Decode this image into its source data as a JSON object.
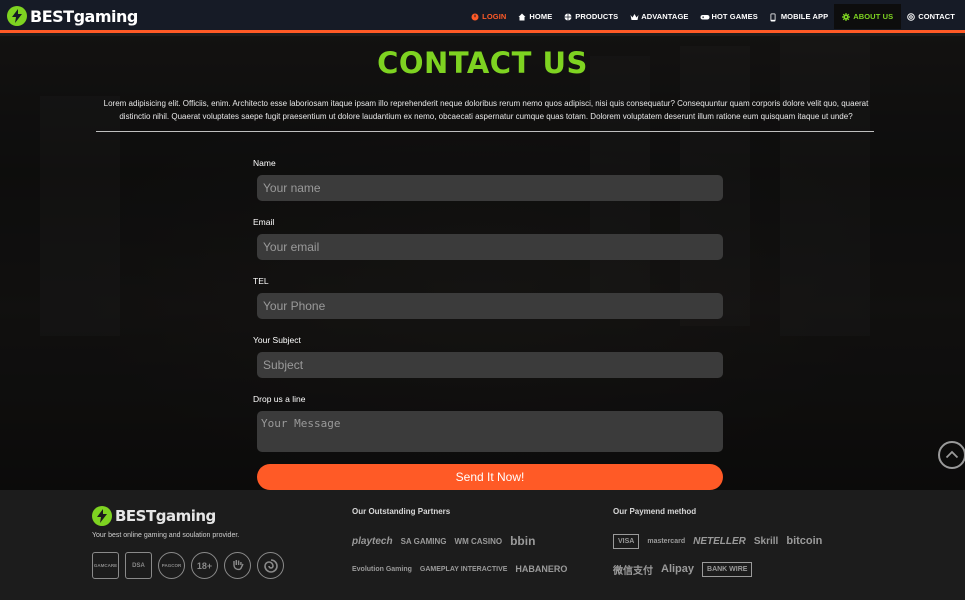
{
  "brand": {
    "name_main": "BEST",
    "name_sub": "gaming"
  },
  "nav": {
    "items": [
      {
        "key": "login",
        "label": "LOGIN",
        "icon": "power-icon"
      },
      {
        "key": "home",
        "label": "HOME",
        "icon": "home-icon"
      },
      {
        "key": "products",
        "label": "PRODUCTS",
        "icon": "globe-icon"
      },
      {
        "key": "advantage",
        "label": "ADVANTAGE",
        "icon": "crown-icon"
      },
      {
        "key": "hot_games",
        "label": "HOT GAMES",
        "icon": "gamepad-icon"
      },
      {
        "key": "mobile_app",
        "label": "MOBILE APP",
        "icon": "mobile-icon"
      },
      {
        "key": "about_us",
        "label": "ABOUT US",
        "icon": "gear-icon"
      },
      {
        "key": "contact",
        "label": "CONTACT",
        "icon": "at-icon"
      }
    ],
    "active": "about_us"
  },
  "contact": {
    "title": "CONTACT US",
    "description": "Lorem adipisicing elit. Officiis, enim. Architecto esse laboriosam itaque ipsam illo reprehenderit neque doloribus rerum nemo quos adipisci, nisi quis consequatur? Consequuntur quam corporis dolore velit quo, quaerat distinctio nihil. Quaerat voluptates saepe fugit praesentium ut dolore laudantium ex nemo, obcaecati aspernatur cumque quas totam. Dolorem voluptatem deserunt illum ratione eum quisquam itaque ut unde?",
    "fields": {
      "name": {
        "label": "Name",
        "placeholder": "Your name",
        "value": ""
      },
      "email": {
        "label": "Email",
        "placeholder": "Your email",
        "value": ""
      },
      "tel": {
        "label": "TEL",
        "placeholder": "Your Phone",
        "value": ""
      },
      "subject": {
        "label": "Your Subject",
        "placeholder": "Subject",
        "value": ""
      },
      "message": {
        "label": "Drop us a line",
        "placeholder": "Your Message",
        "value": ""
      }
    },
    "submit_label": "Send It Now!"
  },
  "footer": {
    "tagline": "Your best online gaming and soulation provider.",
    "badges": [
      "GAMCARE",
      "DSA",
      "PAGCOR",
      "18+",
      "hand-stop-icon",
      "swirl-icon"
    ],
    "partners_title": "Our Outstanding Partners",
    "partners": {
      "row1": [
        "playtech",
        "SA GAMING",
        "WM CASINO",
        "bbin"
      ],
      "row2": [
        "Evolution Gaming",
        "GAMEPLAY INTERACTIVE",
        "HABANERO"
      ]
    },
    "payments_title": "Our Paymend method",
    "payments": {
      "row1": [
        "VISA",
        "mastercard",
        "NETELLER",
        "Skrill",
        "bitcoin"
      ],
      "row2": [
        "微信支付",
        "Alipay",
        "BANK WIRE"
      ]
    }
  },
  "colors": {
    "accent_green": "#7ed321",
    "accent_orange": "#ff5a26",
    "nav_bg": "#161b26"
  }
}
